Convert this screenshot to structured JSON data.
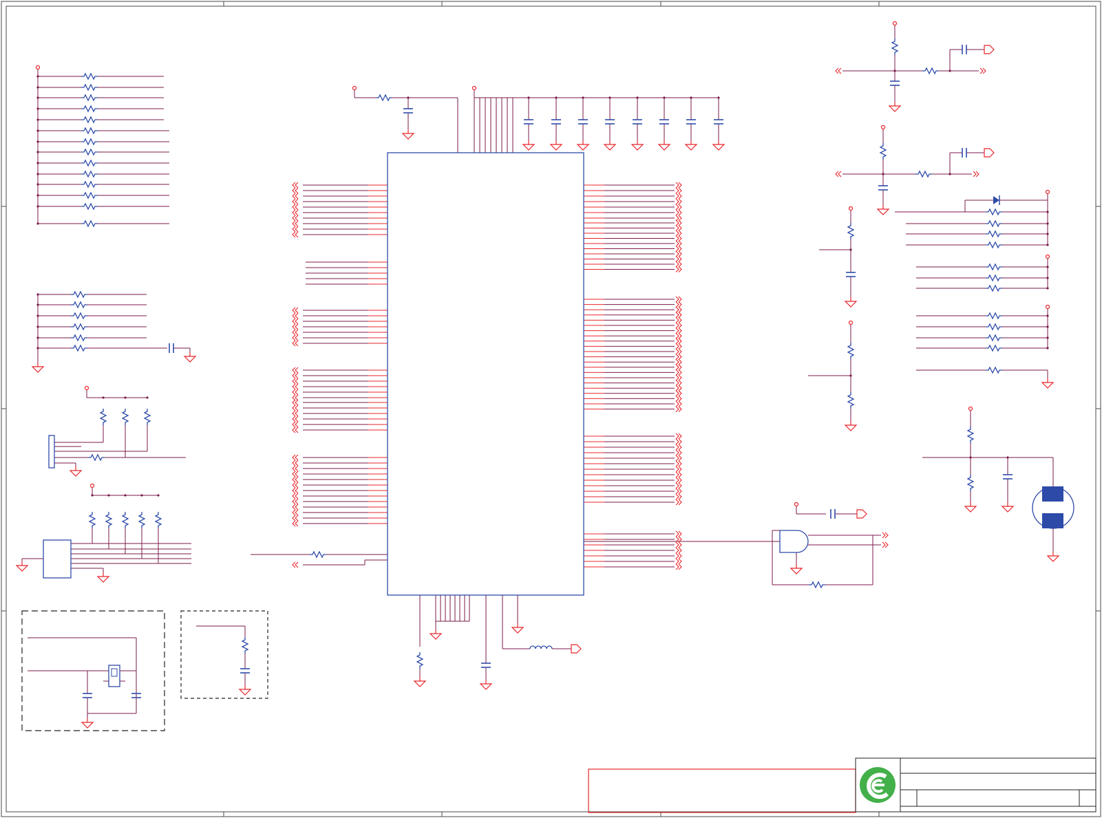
{
  "sheet": {
    "title": "",
    "colors": {
      "background": "#ffffff",
      "wire": "#7a1a4a",
      "pin": "#e8242a",
      "component": "#2d4aa8",
      "power": "#e8242a",
      "frame": "#4a4a4a",
      "logo_green": "#43b049"
    },
    "icons": [
      "resistor-icon",
      "capacitor-icon",
      "ground-icon",
      "power-port-icon",
      "offpage-connector-icon",
      "inductor-icon",
      "diode-icon",
      "and-gate-icon",
      "crystal-icon",
      "buzzer-icon",
      "logo-icon"
    ]
  },
  "title_block": {
    "logo": "logo-icon",
    "rows": [
      "",
      "",
      ""
    ]
  }
}
